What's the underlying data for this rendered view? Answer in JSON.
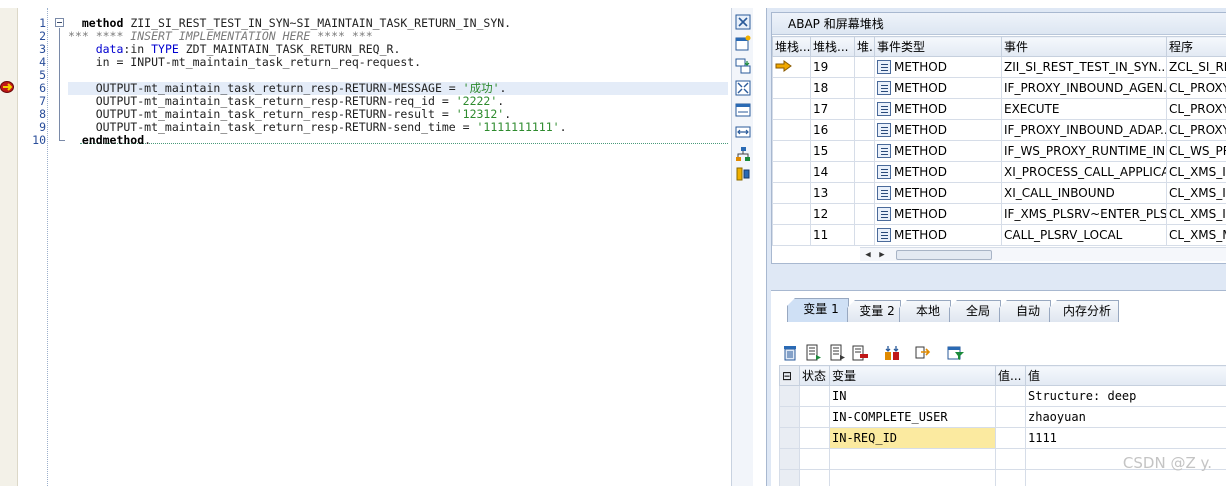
{
  "editor": {
    "lines": [
      {
        "n": "1",
        "segments": [
          {
            "c": "kwb",
            "t": "  method "
          },
          {
            "c": "",
            "t": "ZII_SI_REST_TEST_IN_SYN~SI_MAINTAIN_TASK_RETURN_IN_SYN."
          }
        ]
      },
      {
        "n": "2",
        "segments": [
          {
            "c": "cm",
            "t": "*** **** INSERT IMPLEMENTATION HERE **** ***"
          }
        ]
      },
      {
        "n": "3",
        "segments": [
          {
            "c": "",
            "t": "    "
          },
          {
            "c": "kw",
            "t": "data"
          },
          {
            "c": "",
            "t": ":in "
          },
          {
            "c": "kw",
            "t": "TYPE"
          },
          {
            "c": "",
            "t": " ZDT_MAINTAIN_TASK_RETURN_REQ_R."
          }
        ]
      },
      {
        "n": "4",
        "segments": [
          {
            "c": "",
            "t": "    in = INPUT-mt_maintain_task_return_req-request."
          }
        ]
      },
      {
        "n": "5",
        "segments": [
          {
            "c": "",
            "t": ""
          }
        ]
      },
      {
        "n": "6",
        "segments": [
          {
            "c": "",
            "t": "    OUTPUT-mt_maintain_task_return_resp-RETURN-MESSAGE = "
          },
          {
            "c": "str",
            "t": "'成功'"
          },
          {
            "c": "",
            "t": "."
          }
        ]
      },
      {
        "n": "7",
        "segments": [
          {
            "c": "",
            "t": "    OUTPUT-mt_maintain_task_return_resp-RETURN-req_id = "
          },
          {
            "c": "str",
            "t": "'2222'"
          },
          {
            "c": "",
            "t": "."
          }
        ]
      },
      {
        "n": "8",
        "segments": [
          {
            "c": "",
            "t": "    OUTPUT-mt_maintain_task_return_resp-RETURN-result = "
          },
          {
            "c": "str",
            "t": "'12312'"
          },
          {
            "c": "",
            "t": "."
          }
        ]
      },
      {
        "n": "9",
        "segments": [
          {
            "c": "",
            "t": "    OUTPUT-mt_maintain_task_return_resp-RETURN-send_time = "
          },
          {
            "c": "str",
            "t": "'1111111111'"
          },
          {
            "c": "",
            "t": "."
          }
        ]
      },
      {
        "n": "10",
        "segments": [
          {
            "c": "kwb",
            "t": "  endmethod"
          },
          {
            "c": "",
            "t": "."
          }
        ]
      }
    ],
    "current_line": "6"
  },
  "stack": {
    "title": "ABAP 和屏幕堆栈",
    "columns": [
      "堆栈...",
      "堆栈...",
      "堆.",
      "事件类型",
      "事件",
      "程序"
    ],
    "rows": [
      {
        "current": true,
        "level": "19",
        "type": "METHOD",
        "event": "ZII_SI_REST_TEST_IN_SYN...",
        "program": "ZCL_SI_RES"
      },
      {
        "current": false,
        "level": "18",
        "type": "METHOD",
        "event": "IF_PROXY_INBOUND_AGEN...",
        "program": "CL_PROXY_"
      },
      {
        "current": false,
        "level": "17",
        "type": "METHOD",
        "event": "EXECUTE",
        "program": "CL_PROXY_"
      },
      {
        "current": false,
        "level": "16",
        "type": "METHOD",
        "event": "IF_PROXY_INBOUND_ADAP...",
        "program": "CL_PROXY_"
      },
      {
        "current": false,
        "level": "15",
        "type": "METHOD",
        "event": "IF_WS_PROXY_RUNTIME_IN...",
        "program": "CL_WS_PR"
      },
      {
        "current": false,
        "level": "14",
        "type": "METHOD",
        "event": "XI_PROCESS_CALL_APPLICA...",
        "program": "CL_XMS_IN"
      },
      {
        "current": false,
        "level": "13",
        "type": "METHOD",
        "event": "XI_CALL_INBOUND",
        "program": "CL_XMS_IN"
      },
      {
        "current": false,
        "level": "12",
        "type": "METHOD",
        "event": "IF_XMS_PLSRV~ENTER_PLS...",
        "program": "CL_XMS_IN"
      },
      {
        "current": false,
        "level": "11",
        "type": "METHOD",
        "event": "CALL_PLSRV_LOCAL",
        "program": "CL_XMS_MA"
      }
    ]
  },
  "tabs": [
    {
      "label": "变量 1",
      "active": true
    },
    {
      "label": "变量 2",
      "active": false
    },
    {
      "label": "本地",
      "active": false
    },
    {
      "label": "全局",
      "active": false
    },
    {
      "label": "自动",
      "active": false
    },
    {
      "label": "内存分析",
      "active": false
    }
  ],
  "variables": {
    "columns": [
      "状态",
      "变量",
      "值...",
      "值"
    ],
    "rows": [
      {
        "name": "IN",
        "value": "Structure: deep",
        "editing": false
      },
      {
        "name": "IN-COMPLETE_USER",
        "value": "zhaoyuan",
        "editing": false
      },
      {
        "name": "IN-REQ_ID",
        "value": "1111",
        "editing": true
      },
      {
        "name": "",
        "value": "",
        "editing": false
      },
      {
        "name": "",
        "value": "",
        "editing": false
      }
    ]
  },
  "watermark": "CSDN @Z y.",
  "colors": {
    "accent": "#4a6a9a",
    "highlight": "#e4ecf8",
    "edit": "#fbeaa0"
  }
}
